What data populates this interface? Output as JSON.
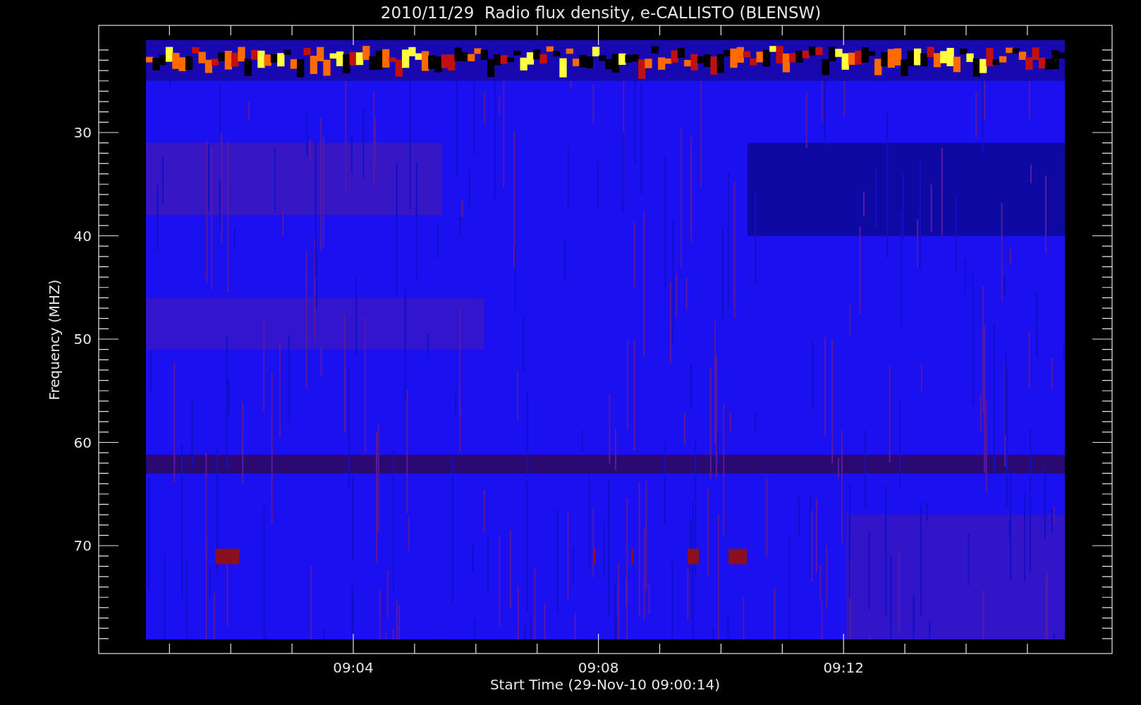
{
  "plot": {
    "title": "2010/11/29  Radio flux density, e-CALLISTO (BLENSW)",
    "ylabel": "Frequency (MHZ)",
    "xlabel": "Start Time (29-Nov-10 09:00:14)",
    "yticks": [
      "30",
      "40",
      "50",
      "60",
      "70"
    ],
    "xticks": [
      "09:04",
      "09:08",
      "09:12"
    ]
  }
}
